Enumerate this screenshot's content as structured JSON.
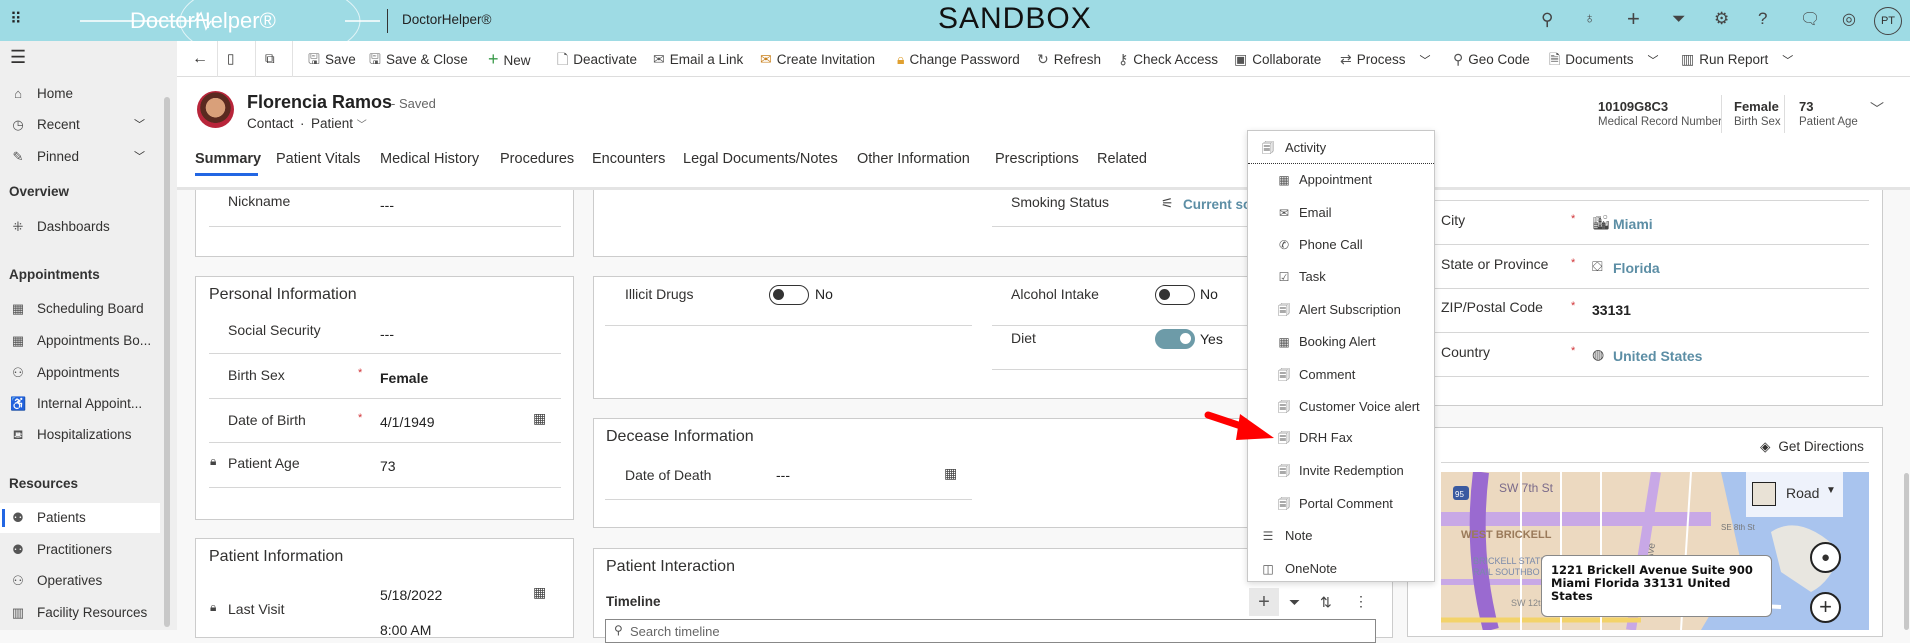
{
  "topbar": {
    "logo": "DoctorHelper®",
    "app_name": "DoctorHelper®",
    "env": "SANDBOX",
    "user_initials": "PT",
    "brand_color": "#9edbe4",
    "icons": [
      "search-icon",
      "lightbulb-icon",
      "plus-icon",
      "filter-icon",
      "gear-icon",
      "help-icon",
      "chat-icon",
      "assistant-icon"
    ]
  },
  "sidebar": {
    "top": [
      {
        "label": "Home",
        "icon": "home-icon"
      },
      {
        "label": "Recent",
        "icon": "clock-icon"
      },
      {
        "label": "Pinned",
        "icon": "pin-icon"
      }
    ],
    "groups": [
      {
        "title": "Overview",
        "items": [
          {
            "label": "Dashboards"
          }
        ]
      },
      {
        "title": "Appointments",
        "items": [
          {
            "label": "Scheduling Board"
          },
          {
            "label": "Appointments Bo..."
          },
          {
            "label": "Appointments"
          },
          {
            "label": "Internal Appoint..."
          },
          {
            "label": "Hospitalizations"
          }
        ]
      },
      {
        "title": "Resources",
        "items": [
          {
            "label": "Patients",
            "selected": true
          },
          {
            "label": "Practitioners"
          },
          {
            "label": "Operatives"
          },
          {
            "label": "Facility Resources"
          }
        ]
      }
    ]
  },
  "commands": [
    "Save",
    "Save & Close",
    "New",
    "Deactivate",
    "Email a Link",
    "Create Invitation",
    "Change Password",
    "Refresh",
    "Check Access",
    "Collaborate",
    "Process",
    "Geo Code",
    "Documents",
    "Run Report"
  ],
  "record": {
    "name": "Florencia Ramos",
    "status": "- Saved",
    "entity": "Contact",
    "separator": "·",
    "form": "Patient",
    "summary": [
      {
        "value": "10109G8C3",
        "label": "Medical Record Number"
      },
      {
        "value": "Female",
        "label": "Birth Sex"
      },
      {
        "value": "73",
        "label": "Patient Age"
      }
    ]
  },
  "tabs": [
    "Summary",
    "Patient Vitals",
    "Medical History",
    "Procedures",
    "Encounters",
    "Legal Documents/Notes",
    "Other Information",
    "Prescriptions",
    "Related"
  ],
  "form": {
    "nickname": {
      "label": "Nickname",
      "value": "---"
    },
    "personal": {
      "title": "Personal Information",
      "social": {
        "label": "Social Security",
        "value": "---"
      },
      "birth_sex": {
        "label": "Birth Sex",
        "value": "Female"
      },
      "dob": {
        "label": "Date of Birth",
        "value": "4/1/1949"
      },
      "age": {
        "label": "Patient Age",
        "value": "73"
      }
    },
    "patient_info": {
      "title": "Patient Information",
      "last_visit": {
        "label": "Last Visit",
        "date": "5/18/2022",
        "time": "8:00 AM"
      }
    },
    "smoking": {
      "label": "Smoking Status",
      "value": "Current sor"
    },
    "illicit": {
      "label": "Illicit Drugs",
      "value": "No",
      "on": false
    },
    "alcohol": {
      "label": "Alcohol Intake",
      "value": "No",
      "on": false
    },
    "diet": {
      "label": "Diet",
      "value": "Yes",
      "on": true
    },
    "decease": {
      "title": "Decease Information",
      "dod": {
        "label": "Date of Death",
        "value": "---"
      }
    },
    "interaction": {
      "title": "Patient Interaction",
      "timeline": "Timeline",
      "search_placeholder": "Search timeline"
    },
    "address": {
      "city": {
        "label": "City",
        "value": "Miami"
      },
      "state": {
        "label": "State or Province",
        "value": "Florida"
      },
      "zip": {
        "label": "ZIP/Postal Code",
        "value": "33131"
      },
      "country": {
        "label": "Country",
        "value": "United States"
      }
    },
    "map": {
      "directions": "Get Directions",
      "style": "Road",
      "popup": "1221 Brickell Avenue Suite 900 Miami Florida 33131 United States",
      "labels": [
        "SW 7th St",
        "WEST BRICKELL",
        "BRICKELL STATI",
        "RAIL SOUTHBO",
        "SE 8th St",
        "SW 12t",
        "ll Ave",
        "95"
      ]
    }
  },
  "menu": {
    "header": "Activity",
    "items": [
      "Appointment",
      "Email",
      "Phone Call",
      "Task",
      "Alert Subscription",
      "Booking Alert",
      "Comment",
      "Customer Voice alert",
      "DRH Fax",
      "Invite Redemption",
      "Portal Comment"
    ],
    "note": "Note",
    "onenote": "OneNote",
    "highlighted": "DRH Fax"
  }
}
